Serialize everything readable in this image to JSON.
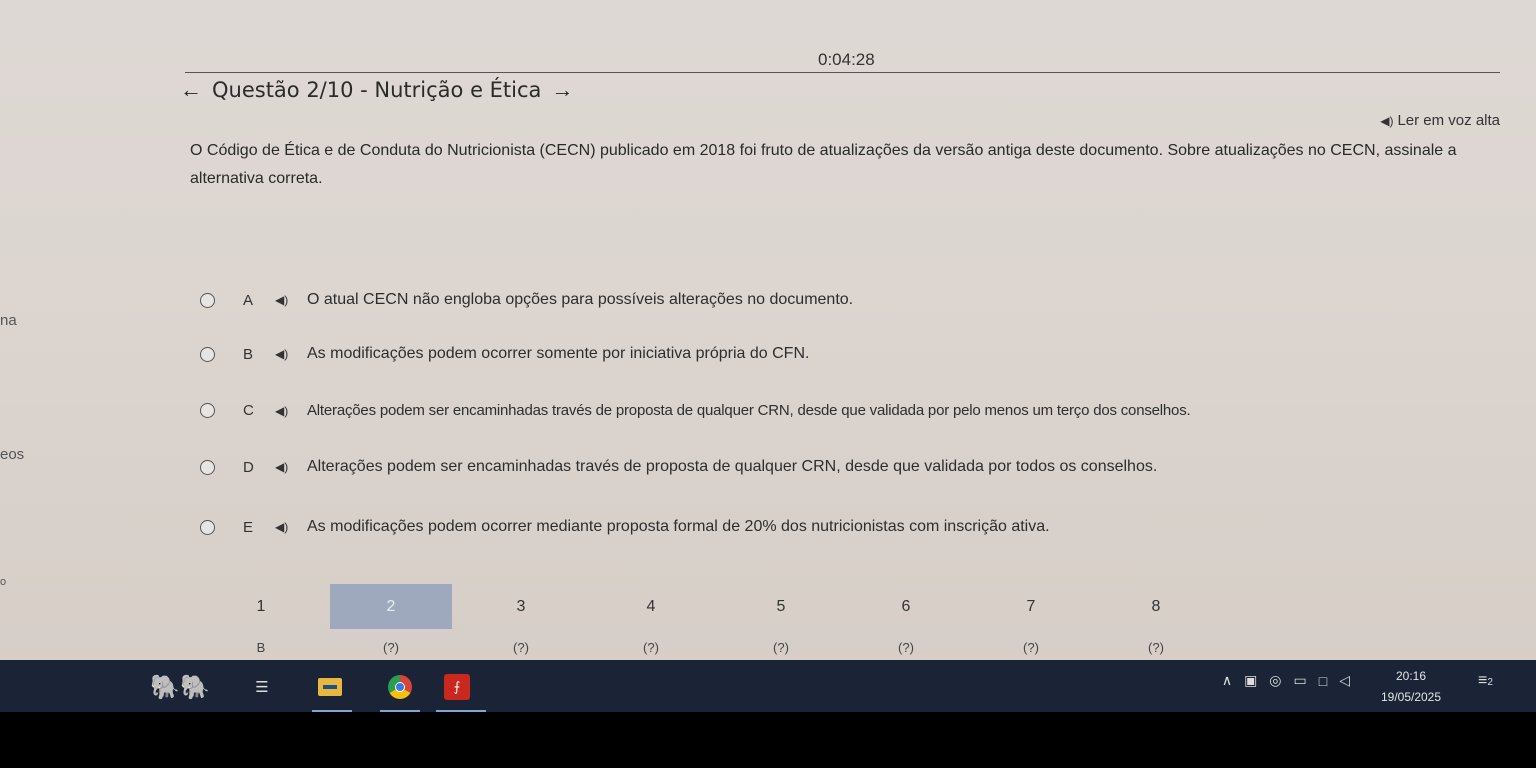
{
  "exam": {
    "timer": "0:04:28",
    "title": "Questão 2/10 - Nutrição e Ética",
    "read_aloud": "Ler em voz alta",
    "question": "O Código de Ética e de Conduta do Nutricionista (CECN) publicado em 2018 foi fruto de atualizações da versão antiga deste documento. Sobre atualizações no CECN, assinale a alternativa correta.",
    "options": [
      {
        "letter": "A",
        "text": "O atual CECN não engloba opções para possíveis alterações no documento."
      },
      {
        "letter": "B",
        "text": "As modificações podem ocorrer somente por iniciativa própria do CFN."
      },
      {
        "letter": "C",
        "text": "Alterações podem ser encaminhadas través de proposta de qualquer CRN, desde que validada por pelo menos um terço dos conselhos."
      },
      {
        "letter": "D",
        "text": "Alterações podem ser encaminhadas través de proposta de qualquer CRN, desde que validada por todos os conselhos."
      },
      {
        "letter": "E",
        "text": "As modificações podem ocorrer mediante proposta formal de 20% dos nutricionistas com inscrição ativa."
      }
    ],
    "left_edge": [
      "na",
      "eos",
      "o"
    ],
    "nav": {
      "numbers": [
        "1",
        "2",
        "3",
        "4",
        "5",
        "6",
        "7",
        "8"
      ],
      "answers": [
        "B",
        "(?)",
        "(?)",
        "(?)",
        "(?)",
        "(?)",
        "(?)",
        "(?)"
      ],
      "active_index": 1
    }
  },
  "taskbar": {
    "time": "20:16",
    "date": "19/05/2025",
    "notification_count": "2",
    "icons": [
      "elephant-icon",
      "task-view-icon",
      "file-explorer-icon",
      "chrome-icon",
      "acrobat-icon"
    ],
    "tray_icons": [
      "chevron-up-icon",
      "app-tray-icon",
      "camera-icon",
      "battery-icon",
      "network-icon",
      "volume-icon"
    ],
    "colors": {
      "taskbar": "#1a2436",
      "active_nav": "#9fa9be"
    }
  }
}
